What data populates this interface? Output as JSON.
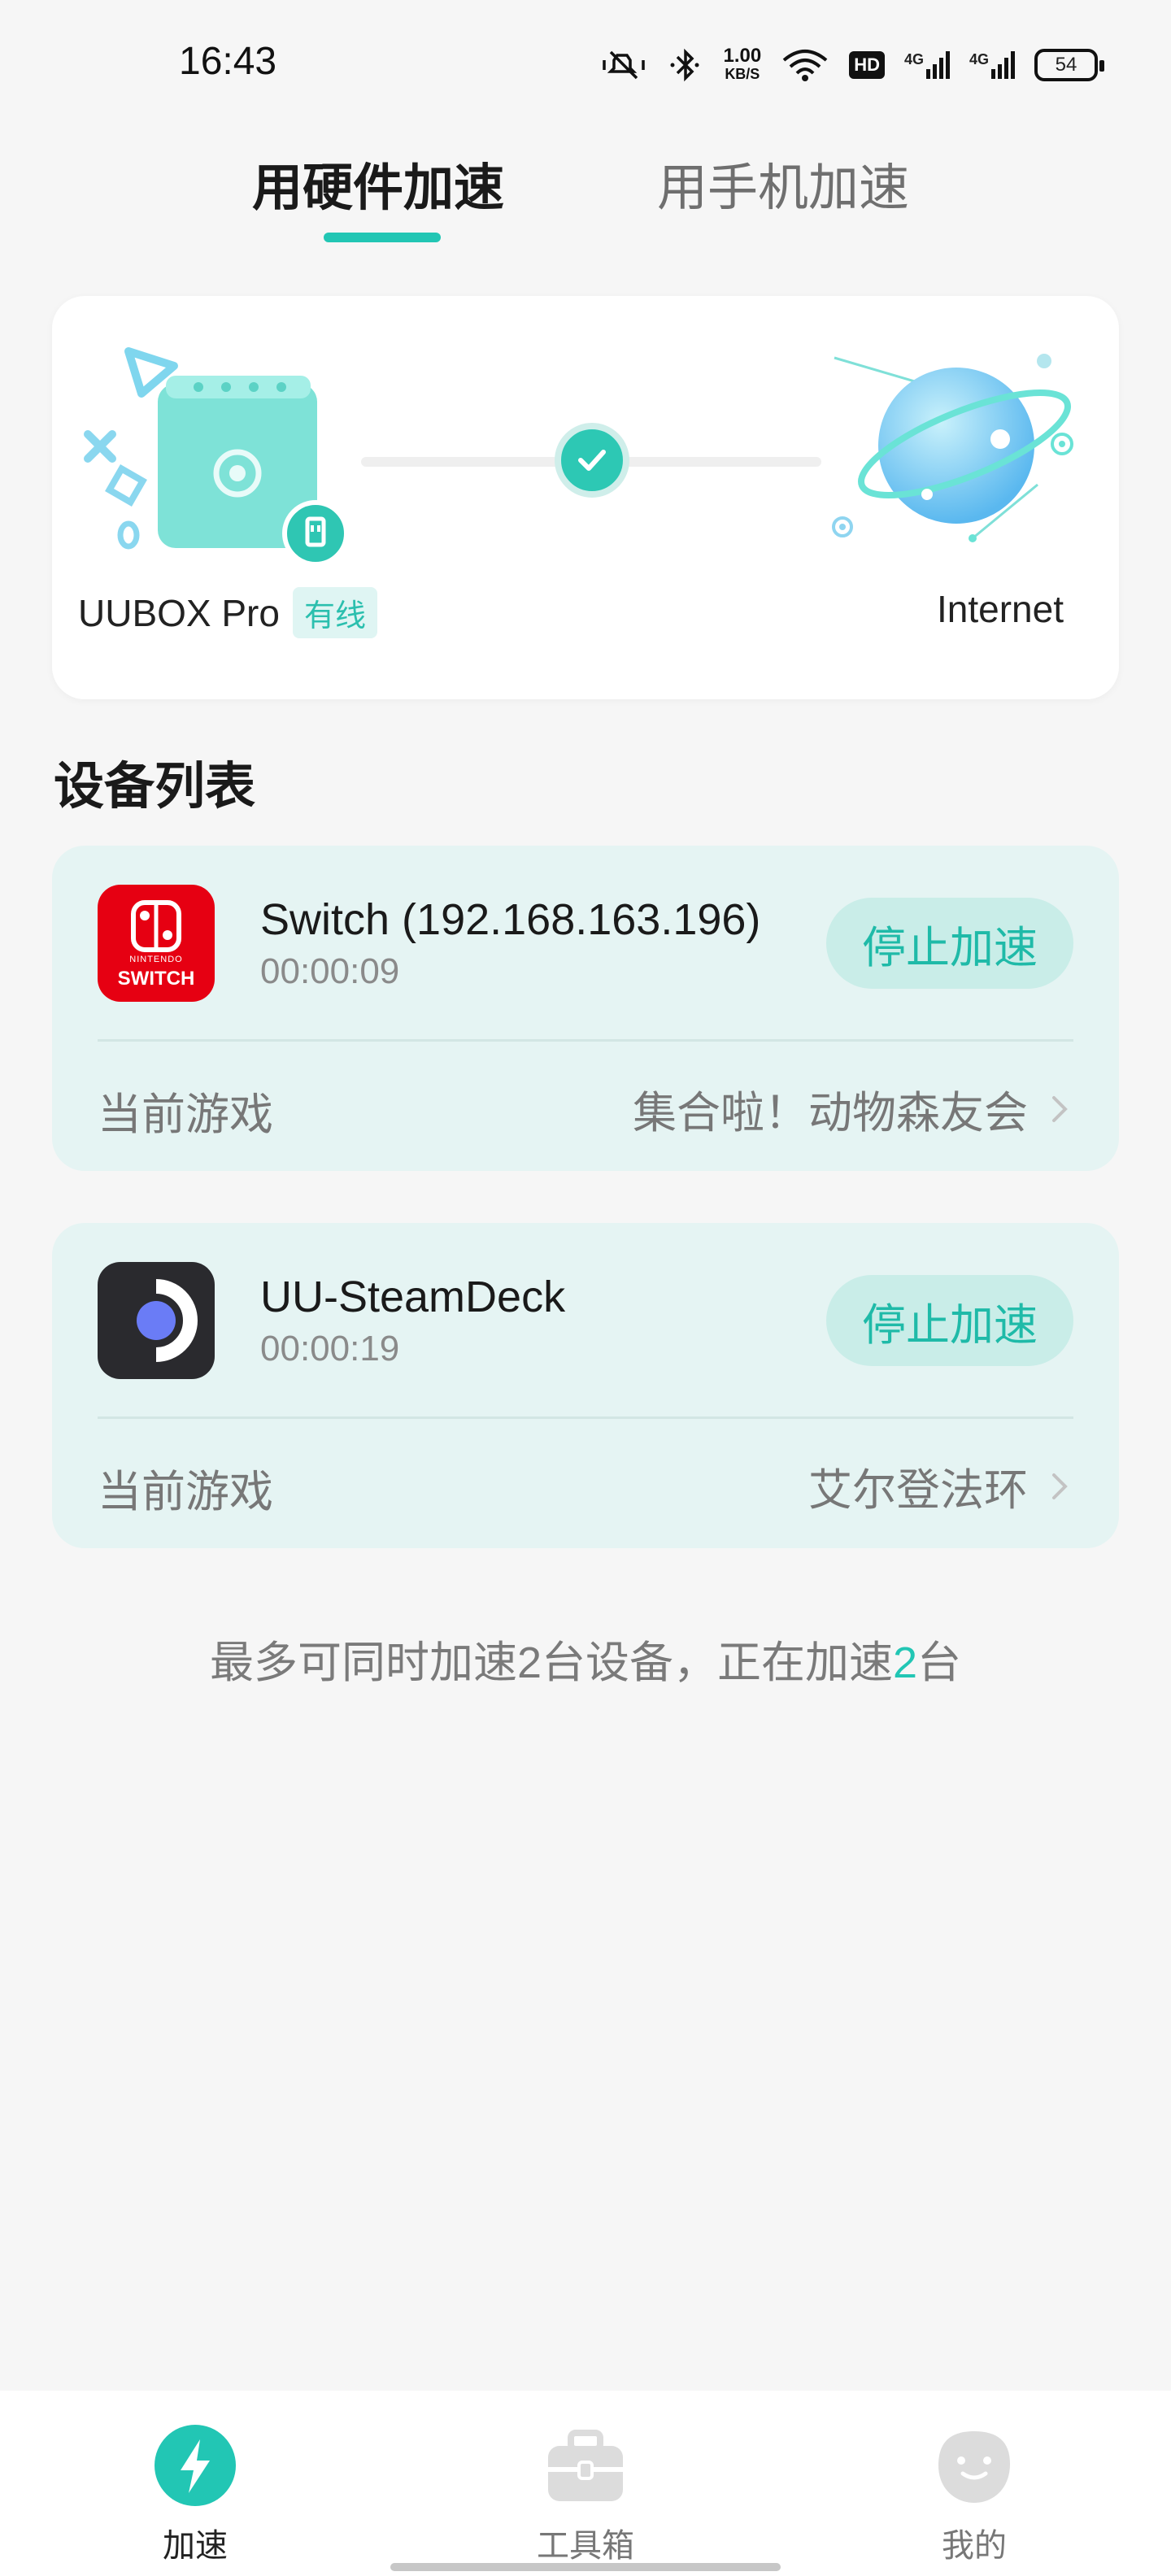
{
  "status_bar": {
    "time": "16:43",
    "net_speed_top": "1.00",
    "net_speed_bottom": "KB/S",
    "hd_label": "HD",
    "signal_label_1": "4G",
    "signal_label_2": "4G",
    "battery": "54"
  },
  "tabs": [
    {
      "label": "用硬件加速",
      "active": true
    },
    {
      "label": "用手机加速",
      "active": false
    }
  ],
  "connection": {
    "device_name": "UUBOX Pro",
    "badge": "有线",
    "target": "Internet"
  },
  "device_list": {
    "title": "设备列表",
    "devices": [
      {
        "name": "Switch (192.168.163.196)",
        "duration": "00:00:09",
        "button": "停止加速",
        "game_label": "当前游戏",
        "game": "集合啦！动物森友会",
        "icon_text_top": "NINTENDO",
        "icon_text_bottom": "SWITCH"
      },
      {
        "name": "UU-SteamDeck",
        "duration": "00:00:19",
        "button": "停止加速",
        "game_label": "当前游戏",
        "game": "艾尔登法环"
      }
    ]
  },
  "footnote": {
    "prefix": "最多可同时加速2台设备，正在加速",
    "count": "2",
    "suffix": "台"
  },
  "bottom_nav": [
    {
      "label": "加速",
      "icon": "lightning-icon",
      "active": true
    },
    {
      "label": "工具箱",
      "icon": "toolbox-icon",
      "active": false
    },
    {
      "label": "我的",
      "icon": "profile-face-icon",
      "active": false
    }
  ],
  "colors": {
    "accent": "#22c6b4",
    "card_bg": "#e5f4f3",
    "switch_red": "#e60012",
    "steamdeck_dark": "#2a2a2e"
  }
}
